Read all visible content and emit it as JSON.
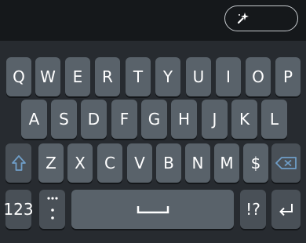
{
  "top_bar": {
    "button_icon": "sparkle-icon"
  },
  "keyboard": {
    "rows": [
      [
        "Q",
        "W",
        "E",
        "R",
        "T",
        "Y",
        "U",
        "I",
        "O",
        "P"
      ],
      [
        "A",
        "S",
        "D",
        "F",
        "G",
        "H",
        "J",
        "K",
        "L"
      ],
      [
        "Z",
        "X",
        "C",
        "V",
        "B",
        "N",
        "M",
        "$"
      ]
    ],
    "shift_icon": "shift-arrow-icon",
    "backspace_icon": "backspace-icon",
    "numbers_label": "123",
    "punctuation_icon": "dots-colon-icon",
    "space_icon": "space-bar-icon",
    "symbols_label": "!?",
    "enter_icon": "enter-return-icon",
    "colors": {
      "key": "#59626a",
      "special_key": "#495057",
      "shift_blue": "#6f9ec8",
      "background": "#272b30"
    }
  }
}
